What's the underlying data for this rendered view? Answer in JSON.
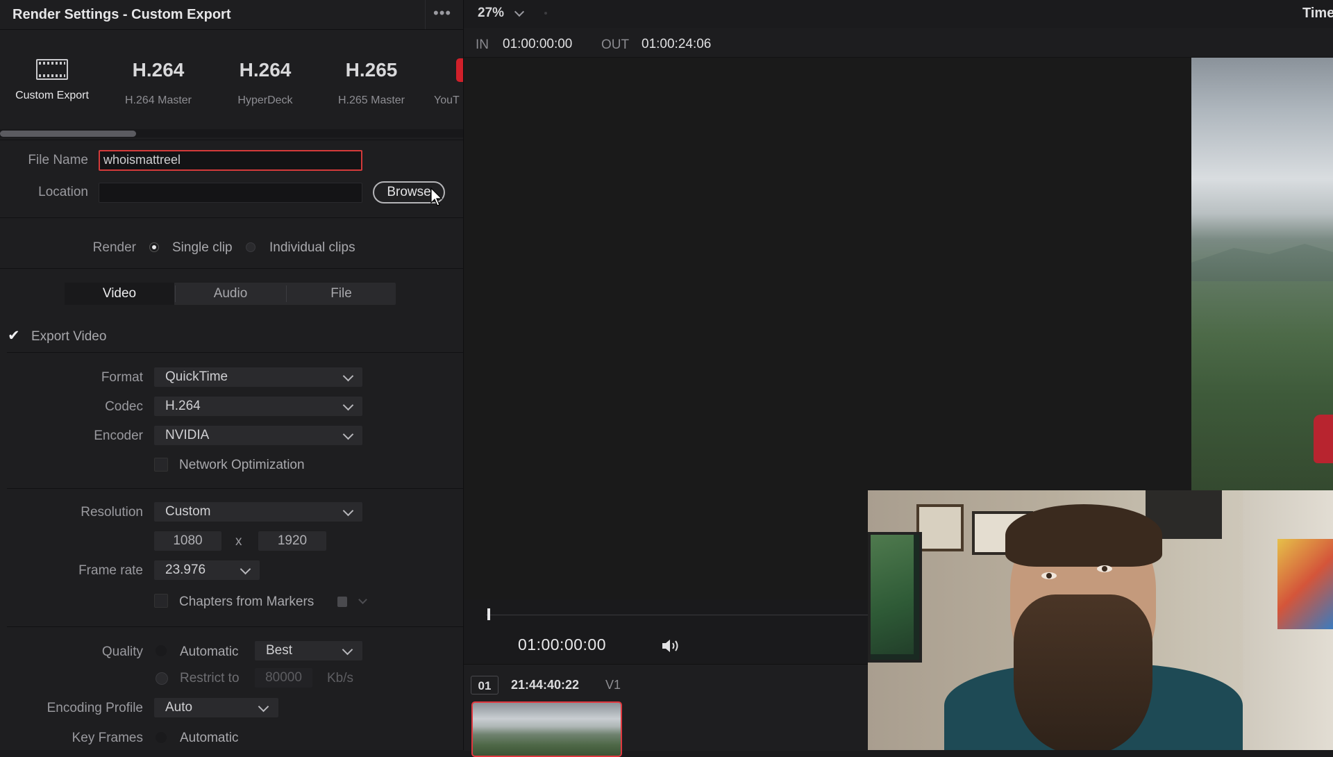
{
  "panel": {
    "title": "Render Settings - Custom Export",
    "more_label": "•••"
  },
  "presets": [
    {
      "big": "",
      "label": "Custom Export",
      "icon": "film-strip-icon"
    },
    {
      "big": "H.264",
      "label": "H.264 Master"
    },
    {
      "big": "H.264",
      "label": "HyperDeck"
    },
    {
      "big": "H.265",
      "label": "H.265 Master"
    },
    {
      "big": "",
      "label": "YouT"
    }
  ],
  "file": {
    "name_label": "File Name",
    "name_value": "whoismattreel",
    "location_label": "Location",
    "location_value": "",
    "browse_label": "Browse"
  },
  "render": {
    "label": "Render",
    "single": "Single clip",
    "individual": "Individual clips"
  },
  "tabs": [
    "Video",
    "Audio",
    "File"
  ],
  "video": {
    "export_label": "Export Video",
    "format_label": "Format",
    "format_value": "QuickTime",
    "codec_label": "Codec",
    "codec_value": "H.264",
    "encoder_label": "Encoder",
    "encoder_value": "NVIDIA",
    "netopt_label": "Network Optimization",
    "resolution_label": "Resolution",
    "resolution_value": "Custom",
    "res_w": "1080",
    "res_x": "x",
    "res_h": "1920",
    "framerate_label": "Frame rate",
    "framerate_value": "23.976",
    "chapters_label": "Chapters from Markers",
    "quality_label": "Quality",
    "quality_auto": "Automatic",
    "quality_value": "Best",
    "restrict_label": "Restrict to",
    "restrict_value": "80000",
    "restrict_unit": "Kb/s",
    "encprof_label": "Encoding Profile",
    "encprof_value": "Auto",
    "keyframes_label": "Key Frames",
    "keyframes_value": "Automatic"
  },
  "viewer": {
    "zoom": "27%",
    "timeline_label": "Time",
    "in_label": "IN",
    "in_tc": "01:00:00:00",
    "out_label": "OUT",
    "out_tc": "01:00:24:06",
    "current_tc": "01:00:00:00"
  },
  "clip": {
    "number": "01",
    "timecode": "21:44:40:22",
    "track": "V1"
  },
  "colors": {
    "accent_red": "#d33a3a",
    "panel_bg": "#1e1e20",
    "text": "#cfcfd1"
  }
}
